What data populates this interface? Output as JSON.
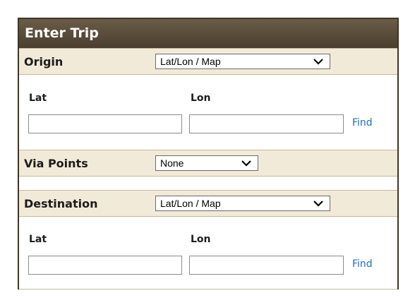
{
  "panel": {
    "title": "Enter Trip"
  },
  "origin": {
    "label": "Origin",
    "mode_value": "Lat/Lon / Map",
    "lat_label": "Lat",
    "lon_label": "Lon",
    "lat_value": "",
    "lon_value": "",
    "find_label": "Find"
  },
  "via": {
    "label": "Via Points",
    "value": "None"
  },
  "destination": {
    "label": "Destination",
    "mode_value": "Lat/Lon / Map",
    "lat_label": "Lat",
    "lon_label": "Lon",
    "lat_value": "",
    "lon_value": "",
    "find_label": "Find"
  },
  "icons": {
    "dropdown": "chevron-down-icon"
  }
}
